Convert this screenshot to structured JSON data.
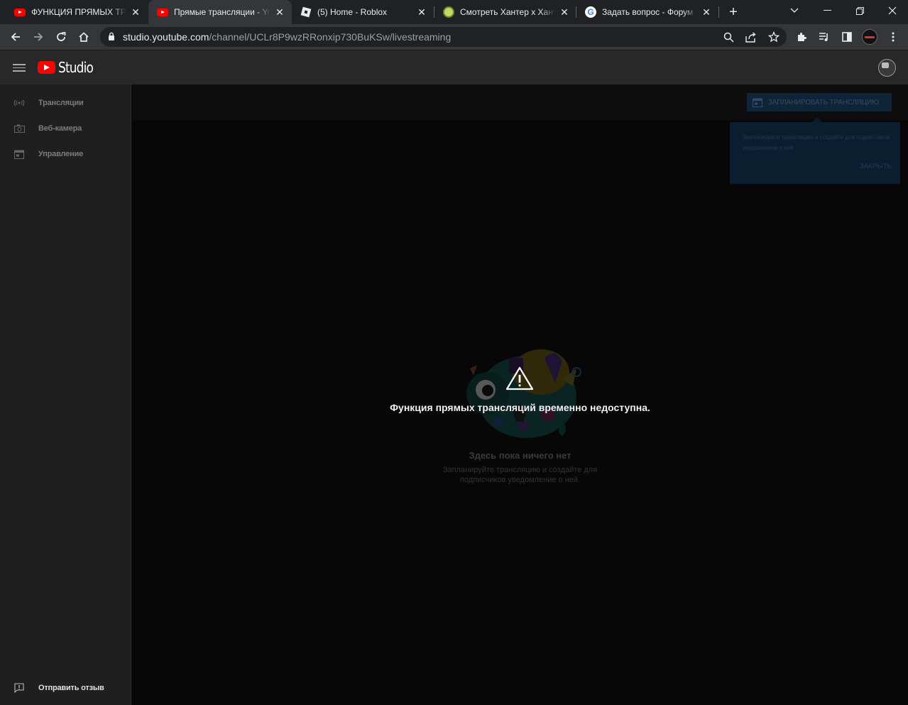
{
  "browser": {
    "tabs": [
      {
        "title": "ФУНКЦИЯ ПРЯМЫХ ТРАНСЛЯЦИЙ ВРЕМЕННО НЕДОСТУПНА",
        "favicon": "youtube-icon",
        "close": "✕"
      },
      {
        "title": "Прямые трансляции - YouTube Studio",
        "favicon": "youtube-icon",
        "close": "✕"
      },
      {
        "title": "(5) Home - Roblox",
        "favicon": "roblox-icon",
        "close": "✕"
      },
      {
        "title": "Смотреть Хантер x Хантер",
        "favicon": "hunter-icon",
        "close": "✕"
      },
      {
        "title": "Задать вопрос - Форум - Google",
        "favicon": "google-icon",
        "close": "✕"
      }
    ],
    "new_tab_glyph": "+",
    "url_host": "studio.youtube.com",
    "url_path": "/channel/UCLr8P9wzRRonxip730BuKSw/livestreaming"
  },
  "studio": {
    "logo_text": "Studio",
    "sidebar": {
      "items": [
        {
          "label": "Трансляции",
          "icon": "broadcast-icon"
        },
        {
          "label": "Веб-камера",
          "icon": "camera-icon"
        },
        {
          "label": "Управление",
          "icon": "calendar-icon"
        }
      ],
      "feedback": {
        "label": "Отправить отзыв",
        "icon": "feedback-icon"
      }
    },
    "main": {
      "schedule_button": "ЗАПЛАНИРОВАТЬ ТРАНСЛЯЦИЮ",
      "tooltip": {
        "text": "Запланируйте трансляцию и создайте для подписчиков уведомление о ней.",
        "close": "ЗАКРЫТЬ"
      },
      "error_message": "Функция прямых трансляций временно недоступна.",
      "empty_title": "Здесь пока ничего нет",
      "empty_description": "Запланируйте трансляцию и создайте для подписчиков уведомление о ней."
    }
  },
  "colors": {
    "brand_red": "#ff0000",
    "sidebar_bg": "#1f1f1f",
    "main_bg": "#070707"
  }
}
